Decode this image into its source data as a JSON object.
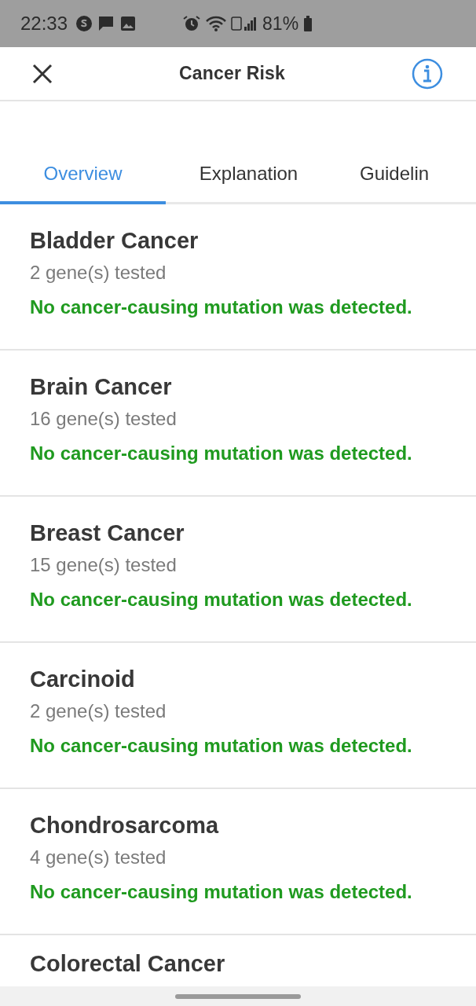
{
  "status_bar": {
    "time": "22:33",
    "battery": "81%"
  },
  "header": {
    "title": "Cancer Risk"
  },
  "tabs": [
    {
      "label": "Overview",
      "selected": true
    },
    {
      "label": "Explanation",
      "selected": false
    },
    {
      "label": "Guidelin",
      "selected": false
    }
  ],
  "items": [
    {
      "name": "Bladder Cancer",
      "genes": "2 gene(s) tested",
      "result": "No cancer-causing mutation was detected."
    },
    {
      "name": "Brain Cancer",
      "genes": "16 gene(s) tested",
      "result": "No cancer-causing mutation was detected."
    },
    {
      "name": "Breast Cancer",
      "genes": "15 gene(s) tested",
      "result": "No cancer-causing mutation was detected."
    },
    {
      "name": "Carcinoid",
      "genes": "2 gene(s) tested",
      "result": "No cancer-causing mutation was detected."
    },
    {
      "name": "Chondrosarcoma",
      "genes": "4 gene(s) tested",
      "result": "No cancer-causing mutation was detected."
    },
    {
      "name": "Colorectal Cancer"
    }
  ]
}
